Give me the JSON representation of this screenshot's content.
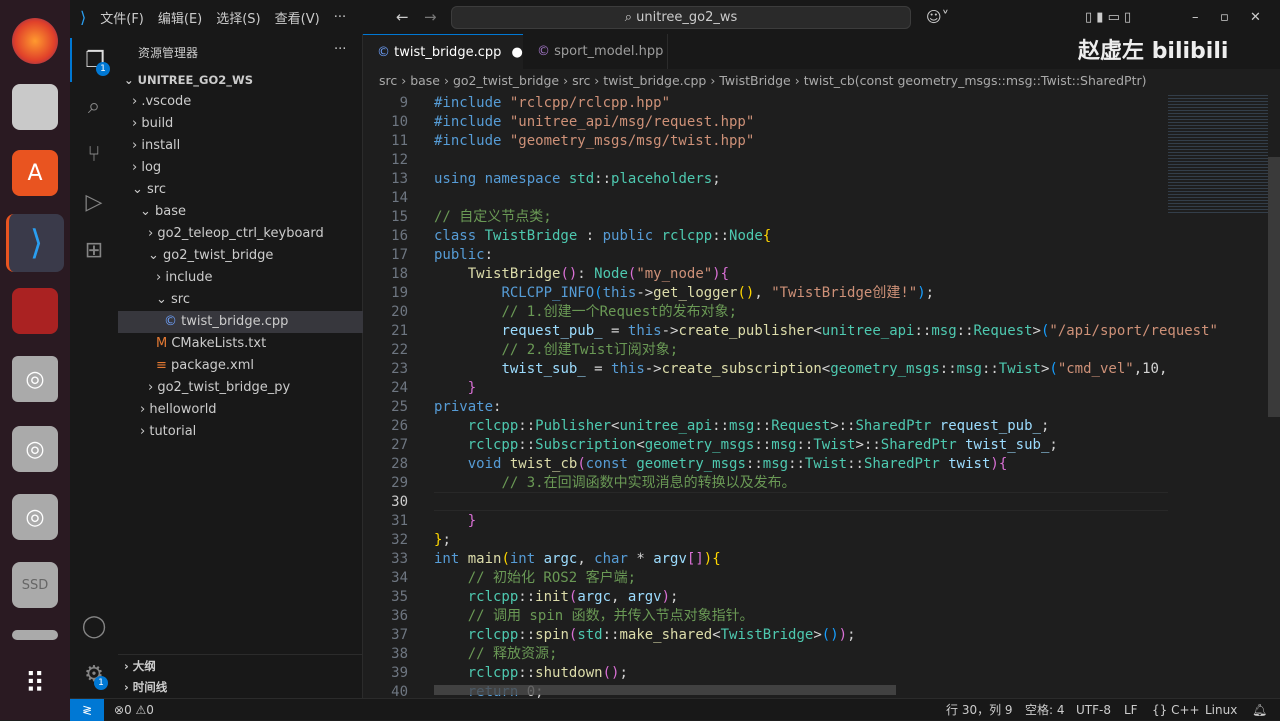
{
  "title_bar": {
    "menus": [
      "文件(F)",
      "编辑(E)",
      "选择(S)",
      "查看(V)",
      "···"
    ],
    "search": "unitree_go2_ws"
  },
  "watermark": {
    "author": "赵虚左",
    "logo": "bilibili"
  },
  "activity": {
    "explorer_badge": "1",
    "settings_badge": "1"
  },
  "sidebar": {
    "title": "资源管理器",
    "more": "···",
    "root": "UNITREE_GO2_WS",
    "items": [
      {
        "label": ".vscode",
        "depth": 1,
        "icon": ">"
      },
      {
        "label": "build",
        "depth": 1,
        "icon": ">"
      },
      {
        "label": "install",
        "depth": 1,
        "icon": ">"
      },
      {
        "label": "log",
        "depth": 1,
        "icon": ">"
      },
      {
        "label": "src",
        "depth": 1,
        "icon": "v"
      },
      {
        "label": "base",
        "depth": 2,
        "icon": "v"
      },
      {
        "label": "go2_teleop_ctrl_keyboard",
        "depth": 3,
        "icon": ">"
      },
      {
        "label": "go2_twist_bridge",
        "depth": 3,
        "icon": "v"
      },
      {
        "label": "include",
        "depth": 4,
        "icon": ">"
      },
      {
        "label": "src",
        "depth": 4,
        "icon": "v"
      },
      {
        "label": "twist_bridge.cpp",
        "depth": 5,
        "icon": "C",
        "selected": true
      },
      {
        "label": "CMakeLists.txt",
        "depth": 4,
        "icon": "M"
      },
      {
        "label": "package.xml",
        "depth": 4,
        "icon": "≡"
      },
      {
        "label": "go2_twist_bridge_py",
        "depth": 3,
        "icon": ">"
      },
      {
        "label": "helloworld",
        "depth": 2,
        "icon": ">"
      },
      {
        "label": "tutorial",
        "depth": 2,
        "icon": ">"
      }
    ],
    "outline": "大纲",
    "timeline": "时间线"
  },
  "tabs": [
    {
      "label": "twist_bridge.cpp",
      "active": true,
      "modified": "●"
    },
    {
      "label": "sport_model.hpp",
      "active": false
    }
  ],
  "breadcrumb": [
    "src",
    "base",
    "go2_twist_bridge",
    "src",
    "twist_bridge.cpp",
    "TwistBridge",
    "twist_cb(const geometry_msgs::msg::Twist::SharedPtr)"
  ],
  "code": [
    {
      "n": "9",
      "t": [
        [
          "#include ",
          "kw"
        ],
        [
          "\"rclcpp/rclcpp.hpp\"",
          "st"
        ]
      ]
    },
    {
      "n": "10",
      "t": [
        [
          "#include ",
          "kw"
        ],
        [
          "\"unitree_api/msg/request.hpp\"",
          "st"
        ]
      ]
    },
    {
      "n": "11",
      "t": [
        [
          "#include ",
          "kw"
        ],
        [
          "\"geometry_msgs/msg/twist.hpp\"",
          "st"
        ]
      ]
    },
    {
      "n": "12",
      "t": []
    },
    {
      "n": "13",
      "t": [
        [
          "using ",
          "kw"
        ],
        [
          "namespace ",
          "kw"
        ],
        [
          "std",
          "ty"
        ],
        [
          "::",
          "pl"
        ],
        [
          "placeholders",
          "ty"
        ],
        [
          ";",
          "pl"
        ]
      ]
    },
    {
      "n": "14",
      "t": []
    },
    {
      "n": "15",
      "t": [
        [
          "// 自定义节点类;",
          "cm"
        ]
      ]
    },
    {
      "n": "16",
      "t": [
        [
          "class ",
          "kw"
        ],
        [
          "TwistBridge",
          "ty"
        ],
        [
          " : ",
          "pl"
        ],
        [
          "public ",
          "kw"
        ],
        [
          "rclcpp",
          "ty"
        ],
        [
          "::",
          "pl"
        ],
        [
          "Node",
          "ty"
        ],
        [
          "{",
          "b1"
        ]
      ]
    },
    {
      "n": "17",
      "t": [
        [
          "public",
          "kw"
        ],
        [
          ":",
          "pl"
        ]
      ]
    },
    {
      "n": "18",
      "t": [
        [
          "    ",
          "pl"
        ],
        [
          "TwistBridge",
          "fn"
        ],
        [
          "()",
          "b2"
        ],
        [
          ": ",
          "pl"
        ],
        [
          "Node",
          "ty"
        ],
        [
          "(",
          "b2"
        ],
        [
          "\"my_node\"",
          "st"
        ],
        [
          ")",
          "b2"
        ],
        [
          "{",
          "b2"
        ]
      ]
    },
    {
      "n": "19",
      "t": [
        [
          "        ",
          "pl"
        ],
        [
          "RCLCPP_INFO",
          "kw"
        ],
        [
          "(",
          "b3"
        ],
        [
          "this",
          "kw"
        ],
        [
          "->",
          "pl"
        ],
        [
          "get_logger",
          "fn"
        ],
        [
          "()",
          "b1"
        ],
        [
          ", ",
          "pl"
        ],
        [
          "\"TwistBridge创建!\"",
          "st"
        ],
        [
          ")",
          "b3"
        ],
        [
          ";",
          "pl"
        ]
      ]
    },
    {
      "n": "20",
      "t": [
        [
          "        ",
          "pl"
        ],
        [
          "// 1.创建一个Request的发布对象;",
          "cm"
        ]
      ]
    },
    {
      "n": "21",
      "t": [
        [
          "        ",
          "pl"
        ],
        [
          "request_pub_",
          "va"
        ],
        [
          " = ",
          "pl"
        ],
        [
          "this",
          "kw"
        ],
        [
          "->",
          "pl"
        ],
        [
          "create_publisher",
          "fn"
        ],
        [
          "<",
          "pl"
        ],
        [
          "unitree_api",
          "ty"
        ],
        [
          "::",
          "pl"
        ],
        [
          "msg",
          "ty"
        ],
        [
          "::",
          "pl"
        ],
        [
          "Request",
          "ty"
        ],
        [
          ">",
          "pl"
        ],
        [
          "(",
          "b3"
        ],
        [
          "\"/api/sport/request\"",
          "st"
        ]
      ]
    },
    {
      "n": "22",
      "t": [
        [
          "        ",
          "pl"
        ],
        [
          "// 2.创建Twist订阅对象;",
          "cm"
        ]
      ]
    },
    {
      "n": "23",
      "t": [
        [
          "        ",
          "pl"
        ],
        [
          "twist_sub_",
          "va"
        ],
        [
          " = ",
          "pl"
        ],
        [
          "this",
          "kw"
        ],
        [
          "->",
          "pl"
        ],
        [
          "create_subscription",
          "fn"
        ],
        [
          "<",
          "pl"
        ],
        [
          "geometry_msgs",
          "ty"
        ],
        [
          "::",
          "pl"
        ],
        [
          "msg",
          "ty"
        ],
        [
          "::",
          "pl"
        ],
        [
          "Twist",
          "ty"
        ],
        [
          ">",
          "pl"
        ],
        [
          "(",
          "b3"
        ],
        [
          "\"cmd_vel\"",
          "st"
        ],
        [
          ",10,",
          "pl"
        ]
      ]
    },
    {
      "n": "24",
      "t": [
        [
          "    ",
          "pl"
        ],
        [
          "}",
          "b2"
        ]
      ]
    },
    {
      "n": "25",
      "t": [
        [
          "private",
          "kw"
        ],
        [
          ":",
          "pl"
        ]
      ]
    },
    {
      "n": "26",
      "t": [
        [
          "    ",
          "pl"
        ],
        [
          "rclcpp",
          "ty"
        ],
        [
          "::",
          "pl"
        ],
        [
          "Publisher",
          "ty"
        ],
        [
          "<",
          "pl"
        ],
        [
          "unitree_api",
          "ty"
        ],
        [
          "::",
          "pl"
        ],
        [
          "msg",
          "ty"
        ],
        [
          "::",
          "pl"
        ],
        [
          "Request",
          "ty"
        ],
        [
          ">::",
          "pl"
        ],
        [
          "SharedPtr",
          "ty"
        ],
        [
          " request_pub_",
          "va"
        ],
        [
          ";",
          "pl"
        ]
      ]
    },
    {
      "n": "27",
      "t": [
        [
          "    ",
          "pl"
        ],
        [
          "rclcpp",
          "ty"
        ],
        [
          "::",
          "pl"
        ],
        [
          "Subscription",
          "ty"
        ],
        [
          "<",
          "pl"
        ],
        [
          "geometry_msgs",
          "ty"
        ],
        [
          "::",
          "pl"
        ],
        [
          "msg",
          "ty"
        ],
        [
          "::",
          "pl"
        ],
        [
          "Twist",
          "ty"
        ],
        [
          ">::",
          "pl"
        ],
        [
          "SharedPtr",
          "ty"
        ],
        [
          " twist_sub_",
          "va"
        ],
        [
          ";",
          "pl"
        ]
      ]
    },
    {
      "n": "28",
      "t": [
        [
          "    ",
          "pl"
        ],
        [
          "void ",
          "kw"
        ],
        [
          "twist_cb",
          "fn"
        ],
        [
          "(",
          "b2"
        ],
        [
          "const ",
          "kw"
        ],
        [
          "geometry_msgs",
          "ty"
        ],
        [
          "::",
          "pl"
        ],
        [
          "msg",
          "ty"
        ],
        [
          "::",
          "pl"
        ],
        [
          "Twist",
          "ty"
        ],
        [
          "::",
          "pl"
        ],
        [
          "SharedPtr",
          "ty"
        ],
        [
          " twist",
          "va"
        ],
        [
          ")",
          "b2"
        ],
        [
          "{",
          "b2"
        ]
      ]
    },
    {
      "n": "29",
      "t": [
        [
          "        ",
          "pl"
        ],
        [
          "// 3.在回调函数中实现消息的转换以及发布。",
          "cm"
        ]
      ]
    },
    {
      "n": "30",
      "t": []
    },
    {
      "n": "31",
      "t": [
        [
          "    ",
          "pl"
        ],
        [
          "}",
          "b2"
        ]
      ]
    },
    {
      "n": "32",
      "t": [
        [
          "}",
          "b1"
        ],
        [
          ";",
          "pl"
        ]
      ]
    },
    {
      "n": "33",
      "t": [
        [
          "int ",
          "kw"
        ],
        [
          "main",
          "fn"
        ],
        [
          "(",
          "b1"
        ],
        [
          "int ",
          "kw"
        ],
        [
          "argc",
          "va"
        ],
        [
          ", ",
          "pl"
        ],
        [
          "char ",
          "kw"
        ],
        [
          "* ",
          "pl"
        ],
        [
          "argv",
          "va"
        ],
        [
          "[]",
          "b2"
        ],
        [
          ")",
          "b1"
        ],
        [
          "{",
          "b1"
        ]
      ]
    },
    {
      "n": "34",
      "t": [
        [
          "    ",
          "pl"
        ],
        [
          "// 初始化 ROS2 客户端;",
          "cm"
        ]
      ]
    },
    {
      "n": "35",
      "t": [
        [
          "    ",
          "pl"
        ],
        [
          "rclcpp",
          "ty"
        ],
        [
          "::",
          "pl"
        ],
        [
          "init",
          "fn"
        ],
        [
          "(",
          "b2"
        ],
        [
          "argc",
          "va"
        ],
        [
          ", ",
          "pl"
        ],
        [
          "argv",
          "va"
        ],
        [
          ")",
          "b2"
        ],
        [
          ";",
          "pl"
        ]
      ]
    },
    {
      "n": "36",
      "t": [
        [
          "    ",
          "pl"
        ],
        [
          "// 调用 spin 函数，并传入节点对象指针。",
          "cm"
        ]
      ]
    },
    {
      "n": "37",
      "t": [
        [
          "    ",
          "pl"
        ],
        [
          "rclcpp",
          "ty"
        ],
        [
          "::",
          "pl"
        ],
        [
          "spin",
          "fn"
        ],
        [
          "(",
          "b2"
        ],
        [
          "std",
          "ty"
        ],
        [
          "::",
          "pl"
        ],
        [
          "make_shared",
          "fn"
        ],
        [
          "<",
          "pl"
        ],
        [
          "TwistBridge",
          "ty"
        ],
        [
          ">",
          "pl"
        ],
        [
          "()",
          "b3"
        ],
        [
          ")",
          "b2"
        ],
        [
          ";",
          "pl"
        ]
      ]
    },
    {
      "n": "38",
      "t": [
        [
          "    ",
          "pl"
        ],
        [
          "// 释放资源;",
          "cm"
        ]
      ]
    },
    {
      "n": "39",
      "t": [
        [
          "    ",
          "pl"
        ],
        [
          "rclcpp",
          "ty"
        ],
        [
          "::",
          "pl"
        ],
        [
          "shutdown",
          "fn"
        ],
        [
          "()",
          "b2"
        ],
        [
          ";",
          "pl"
        ]
      ]
    },
    {
      "n": "40",
      "t": [
        [
          "    ",
          "pl"
        ],
        [
          "return ",
          "kw"
        ],
        [
          "0",
          "pl"
        ],
        [
          ";",
          "pl"
        ]
      ]
    }
  ],
  "status": {
    "errors": "0",
    "warnings": "0",
    "position": "行 30，列 9",
    "spaces": "空格: 4",
    "encoding": "UTF-8",
    "eol": "LF",
    "language": "C++",
    "os": "Linux"
  }
}
